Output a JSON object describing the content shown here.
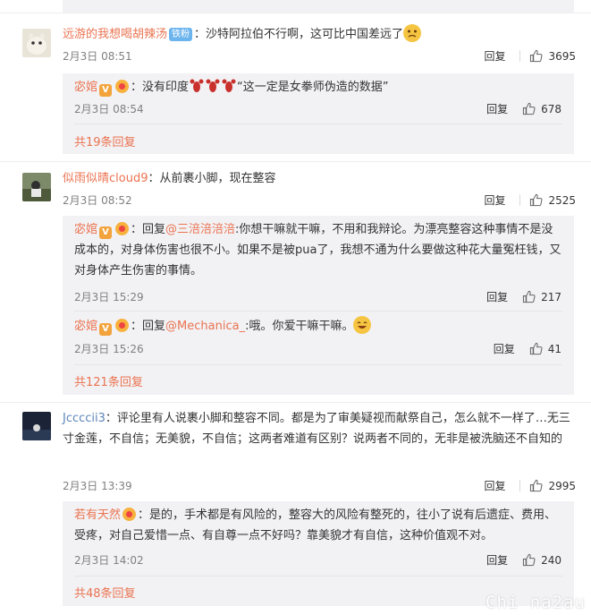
{
  "comments": [
    {
      "user": "远游的我想喝胡辣汤",
      "fan_badge": "铁粉",
      "text": "：沙特阿拉伯不行啊，这可比中国差远了",
      "date": "2月3日 08:51",
      "reply_label": "回复",
      "likes": "3695",
      "sub_replies": [
        {
          "user": "宓婠",
          "text_prefix": "：没有印度",
          "text_suffix": "“这一定是女拳师伪造的数据”",
          "date": "2月3日 08:54",
          "reply_label": "回复",
          "likes": "678"
        }
      ],
      "more": "共19条回复"
    },
    {
      "user": "似雨似晴cloud9",
      "text": "：从前裹小脚，现在整容",
      "date": "2月3日 08:52",
      "reply_label": "回复",
      "likes": "2525",
      "sub_replies": [
        {
          "user": "宓婠",
          "reply_word": "：回复",
          "mention": "@三涪涪涪涪",
          "text": ":你想干嘛就干嘛，不用和我辩论。为漂亮整容这种事情不是没成本的，对身体伤害也很不小。如果不是被pua了，我想不通为什么要做这种花大量冤枉钱，又对身体产生伤害的事情。",
          "date": "2月3日 15:29",
          "reply_label": "回复",
          "likes": "217"
        },
        {
          "user": "宓婠",
          "reply_word": "：回复",
          "mention": "@Mechanica_",
          "text": ":哦。你爱干嘛干嘛。",
          "date": "2月3日 15:26",
          "reply_label": "回复",
          "likes": "41"
        }
      ],
      "more": "共121条回复"
    },
    {
      "user": "Jccccii3",
      "text": "：评论里有人说裹小脚和整容不同。都是为了审美疑视而献祭自己，怎么就不一样了…无三寸金莲，不自信；无美貌，不自信；这两者难道有区别？说两者不同的，无非是被洗脑还不自知的",
      "date": "2月3日 13:39",
      "reply_label": "回复",
      "likes": "2995",
      "sub_replies": [
        {
          "user": "若有天然",
          "text": "：是的，手术都是有风险的，整容大的风险有整死的，往小了说有后遗症、费用、受疼，对自己爱惜一点、有自尊一点不好吗？靠美貌才有自信，这种价值观不对。",
          "date": "2月3日 14:02",
          "reply_label": "回复",
          "likes": "240"
        }
      ],
      "more": "共48条回复"
    }
  ],
  "watermark": "Chi na2au",
  "colors": {
    "link": "#eb7350",
    "username": "#5d85b9",
    "subbox_bg": "#f2f2f5"
  }
}
